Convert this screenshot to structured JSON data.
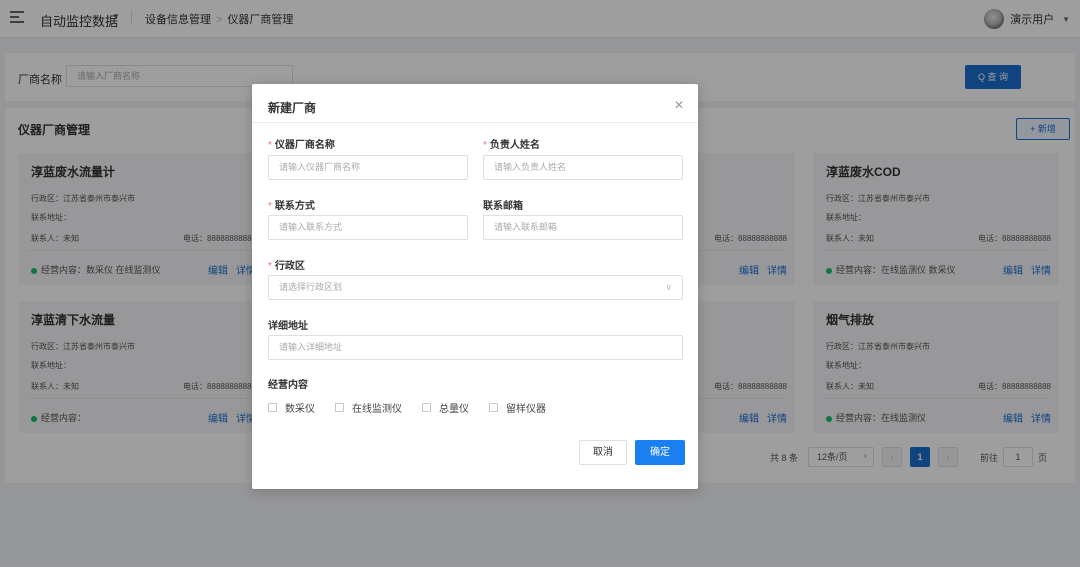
{
  "topbar": {
    "system_title": "自动监控数据",
    "breadcrumb": [
      "设备信息管理",
      "仪器厂商管理"
    ],
    "user_name": "演示用户"
  },
  "search": {
    "label": "厂商名称",
    "placeholder": "请输入厂商名称",
    "query_label": "Q 查 询"
  },
  "main": {
    "title": "仪器厂商管理",
    "add_label": "+ 新增"
  },
  "cards": [
    {
      "name": "淳蓝废水流量计",
      "region": "行政区：江苏省泰州市泰兴市",
      "address": "联系地址：",
      "contact": "联系人：未知",
      "phone": "电话：88888888888",
      "scope": "经营内容：数采仪 在线监测仪",
      "edit": "编辑",
      "detail": "详情"
    },
    {
      "name": "淳蓝废水COD",
      "region": "行政区：江苏省泰州市泰兴市",
      "address": "联系地址：",
      "contact": "联系人：未知",
      "phone": "电话：88888888888",
      "scope": "经营内容：在线监测仪 数采仪",
      "edit": "编辑",
      "detail": "详情"
    },
    {
      "name": "淳蓝清下水流量",
      "region": "行政区：江苏省泰州市泰兴市",
      "address": "联系地址：",
      "contact": "联系人：未知",
      "phone": "电话：88888888888",
      "scope": "经营内容：",
      "edit": "编辑",
      "detail": "详情"
    },
    {
      "name": "烟气排放",
      "region": "行政区：江苏省泰州市泰兴市",
      "address": "联系地址：",
      "contact": "联系人：未知",
      "phone": "电话：88888888888",
      "scope": "经营内容：在线监测仪",
      "edit": "编辑",
      "detail": "详情"
    },
    {
      "phone": "电话：88888888888",
      "edit": "编辑",
      "detail": "详情"
    },
    {
      "phone": "电话：88888888888",
      "edit": "编辑",
      "detail": "详情"
    }
  ],
  "pagination": {
    "total": "共 8 条",
    "page_size": "12条/页",
    "current_page": "1",
    "goto_label": "前往",
    "goto_value": "1",
    "goto_unit": "页"
  },
  "dialog": {
    "title": "新建厂商",
    "fields": {
      "name": {
        "label": "仪器厂商名称",
        "placeholder": "请输入仪器厂商名称"
      },
      "owner": {
        "label": "负责人姓名",
        "placeholder": "请输入负责人姓名"
      },
      "contact": {
        "label": "联系方式",
        "placeholder": "请输入联系方式"
      },
      "email": {
        "label": "联系邮箱",
        "placeholder": "请输入联系邮箱"
      },
      "region": {
        "label": "行政区",
        "placeholder": "请选择行政区划"
      },
      "address": {
        "label": "详细地址",
        "placeholder": "请输入详细地址"
      },
      "scope": {
        "label": "经营内容"
      }
    },
    "options": [
      "数采仪",
      "在线监测仪",
      "总量仪",
      "留样仪器"
    ],
    "cancel_label": "取消",
    "confirm_label": "确定"
  }
}
